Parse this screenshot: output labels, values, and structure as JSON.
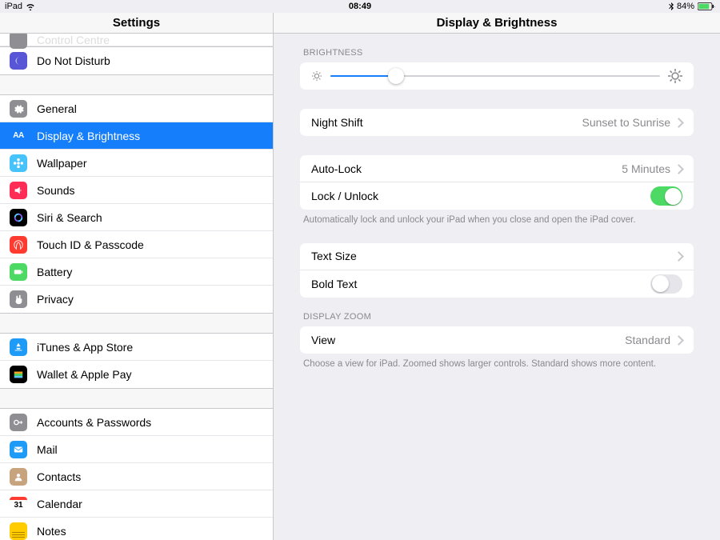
{
  "status": {
    "device": "iPad",
    "time": "08:49",
    "battery": "84%"
  },
  "sidebar_title": "Settings",
  "detail_title": "Display & Brightness",
  "sidebar": {
    "cut_row": "Control Centre",
    "g1": [
      {
        "label": "Do Not Disturb",
        "bg": "#5856d6",
        "icon": "moon"
      }
    ],
    "g2": [
      {
        "label": "General",
        "bg": "#8e8e93",
        "icon": "gear"
      },
      {
        "label": "Display & Brightness",
        "bg": "#157efb",
        "icon": "aa",
        "selected": true
      },
      {
        "label": "Wallpaper",
        "bg": "#46c3fb",
        "icon": "flower"
      },
      {
        "label": "Sounds",
        "bg": "#ff2d55",
        "icon": "sound"
      },
      {
        "label": "Siri & Search",
        "bg": "#000000",
        "icon": "siri"
      },
      {
        "label": "Touch ID & Passcode",
        "bg": "#ff3b30",
        "icon": "finger"
      },
      {
        "label": "Battery",
        "bg": "#4cd964",
        "icon": "battery"
      },
      {
        "label": "Privacy",
        "bg": "#8e8e93",
        "icon": "hand"
      }
    ],
    "g3": [
      {
        "label": "iTunes & App Store",
        "bg": "#1d9bf6",
        "icon": "appstore"
      },
      {
        "label": "Wallet & Apple Pay",
        "bg": "#000000",
        "icon": "wallet"
      }
    ],
    "g4": [
      {
        "label": "Accounts & Passwords",
        "bg": "#8e8e93",
        "icon": "key"
      },
      {
        "label": "Mail",
        "bg": "#1d9bf6",
        "icon": "mail"
      },
      {
        "label": "Contacts",
        "bg": "#c7a37e",
        "icon": "contact"
      },
      {
        "label": "Calendar",
        "bg": "#ffffff",
        "icon": "cal"
      },
      {
        "label": "Notes",
        "bg": "#ffcc00",
        "icon": "notes"
      }
    ]
  },
  "detail": {
    "brightness_label": "BRIGHTNESS",
    "brightness_pct": 20,
    "night_shift": {
      "label": "Night Shift",
      "value": "Sunset to Sunrise"
    },
    "auto_lock": {
      "label": "Auto-Lock",
      "value": "5 Minutes"
    },
    "lock_unlock": {
      "label": "Lock / Unlock",
      "on": true
    },
    "lock_footer": "Automatically lock and unlock your iPad when you close and open the iPad cover.",
    "text_size": {
      "label": "Text Size"
    },
    "bold_text": {
      "label": "Bold Text",
      "on": false
    },
    "zoom_label": "DISPLAY ZOOM",
    "view": {
      "label": "View",
      "value": "Standard"
    },
    "zoom_footer": "Choose a view for iPad. Zoomed shows larger controls. Standard shows more content."
  }
}
